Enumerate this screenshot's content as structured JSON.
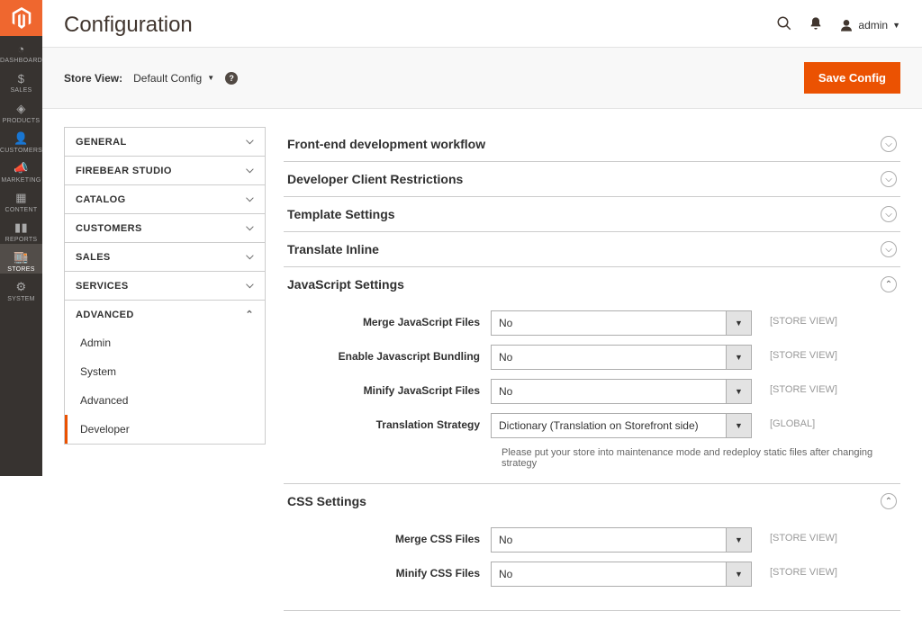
{
  "sidebar": {
    "items": [
      {
        "label": "DASHBOARD",
        "icon": "dashboard"
      },
      {
        "label": "SALES",
        "icon": "sales"
      },
      {
        "label": "PRODUCTS",
        "icon": "products"
      },
      {
        "label": "CUSTOMERS",
        "icon": "customers"
      },
      {
        "label": "MARKETING",
        "icon": "marketing"
      },
      {
        "label": "CONTENT",
        "icon": "content"
      },
      {
        "label": "REPORTS",
        "icon": "reports"
      },
      {
        "label": "STORES",
        "icon": "stores"
      },
      {
        "label": "SYSTEM",
        "icon": "system"
      }
    ]
  },
  "header": {
    "title": "Configuration",
    "user": "admin"
  },
  "storebar": {
    "label": "Store View:",
    "selected": "Default Config",
    "save_label": "Save Config"
  },
  "config_tabs": [
    {
      "label": "GENERAL"
    },
    {
      "label": "FIREBEAR STUDIO"
    },
    {
      "label": "CATALOG"
    },
    {
      "label": "CUSTOMERS"
    },
    {
      "label": "SALES"
    },
    {
      "label": "SERVICES"
    },
    {
      "label": "ADVANCED",
      "expanded": true,
      "children": [
        {
          "label": "Admin"
        },
        {
          "label": "System"
        },
        {
          "label": "Advanced"
        },
        {
          "label": "Developer",
          "active": true
        }
      ]
    }
  ],
  "sections": {
    "frontend": {
      "title": "Front-end development workflow"
    },
    "restrictions": {
      "title": "Developer Client Restrictions"
    },
    "template": {
      "title": "Template Settings"
    },
    "translate": {
      "title": "Translate Inline"
    },
    "js": {
      "title": "JavaScript Settings",
      "merge_label": "Merge JavaScript Files",
      "merge_value": "No",
      "bundle_label": "Enable Javascript Bundling",
      "bundle_value": "No",
      "minify_label": "Minify JavaScript Files",
      "minify_value": "No",
      "strategy_label": "Translation Strategy",
      "strategy_value": "Dictionary (Translation on Storefront side)",
      "strategy_note": "Please put your store into maintenance mode and redeploy static files after changing strategy",
      "scope_store": "[STORE VIEW]",
      "scope_global": "[GLOBAL]"
    },
    "css": {
      "title": "CSS Settings",
      "merge_label": "Merge CSS Files",
      "merge_value": "No",
      "minify_label": "Minify CSS Files",
      "minify_value": "No",
      "scope_store": "[STORE VIEW]"
    }
  }
}
